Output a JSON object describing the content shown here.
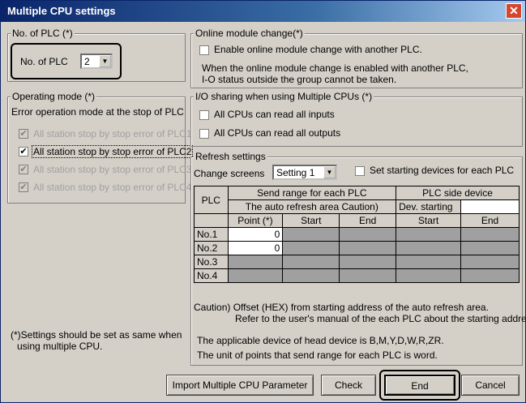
{
  "window": {
    "title": "Multiple CPU settings"
  },
  "no_of_plc": {
    "legend": "No. of PLC (*)",
    "label": "No. of PLC",
    "value": "2"
  },
  "online_change": {
    "legend": "Online module change(*)",
    "checkbox_label": "Enable online module change with another PLC.",
    "note_line1": "When the online module change is enabled  with another PLC,",
    "note_line2": "I-O status outside the group cannot be taken."
  },
  "operating_mode": {
    "legend": "Operating mode (*)",
    "subtitle": "Error operation mode at the stop of PLC",
    "options": [
      {
        "label": "All station stop by stop error of PLC1",
        "checked": true,
        "enabled": false
      },
      {
        "label": "All station stop by stop error of PLC2",
        "checked": true,
        "enabled": true
      },
      {
        "label": "All station stop by stop error of PLC3",
        "checked": true,
        "enabled": false
      },
      {
        "label": "All station stop by stop error of PLC4",
        "checked": true,
        "enabled": false
      }
    ]
  },
  "io_sharing": {
    "legend": "I/O sharing when using Multiple CPUs (*)",
    "inputs_label": "All CPUs can read all inputs",
    "outputs_label": "All CPUs can read all outputs"
  },
  "refresh": {
    "legend": "Refresh settings",
    "change_screens_label": "Change screens",
    "screen_value": "Setting 1",
    "set_starting_label": "Set starting devices for each PLC",
    "table": {
      "plc_header": "PLC",
      "send_range_header": "Send range for each PLC",
      "auto_refresh_header": "The auto refresh area  Caution)",
      "plc_side_header": "PLC side device",
      "dev_starting_header": "Dev. starting",
      "col_point": "Point (*)",
      "col_start": "Start",
      "col_end": "End",
      "col_side_start": "Start",
      "col_side_end": "End",
      "rows": [
        {
          "plc": "No.1",
          "point": "0"
        },
        {
          "plc": "No.2",
          "point": "0"
        },
        {
          "plc": "No.3",
          "point": ""
        },
        {
          "plc": "No.4",
          "point": ""
        }
      ]
    },
    "caution_line1": "Caution)  Offset (HEX) from starting address of the auto refresh area.",
    "caution_line2": "Refer to the user's manual of the each PLC about the starting address.",
    "device_note": "The applicable device of head device is B,M,Y,D,W,R,ZR.",
    "unit_note": "The unit of points that send range for each PLC is word."
  },
  "settings_note_line1": "(*)Settings should be set as same when",
  "settings_note_line2": "using multiple CPU.",
  "buttons": {
    "import": "Import Multiple CPU Parameter",
    "check": "Check",
    "end": "End",
    "cancel": "Cancel"
  }
}
